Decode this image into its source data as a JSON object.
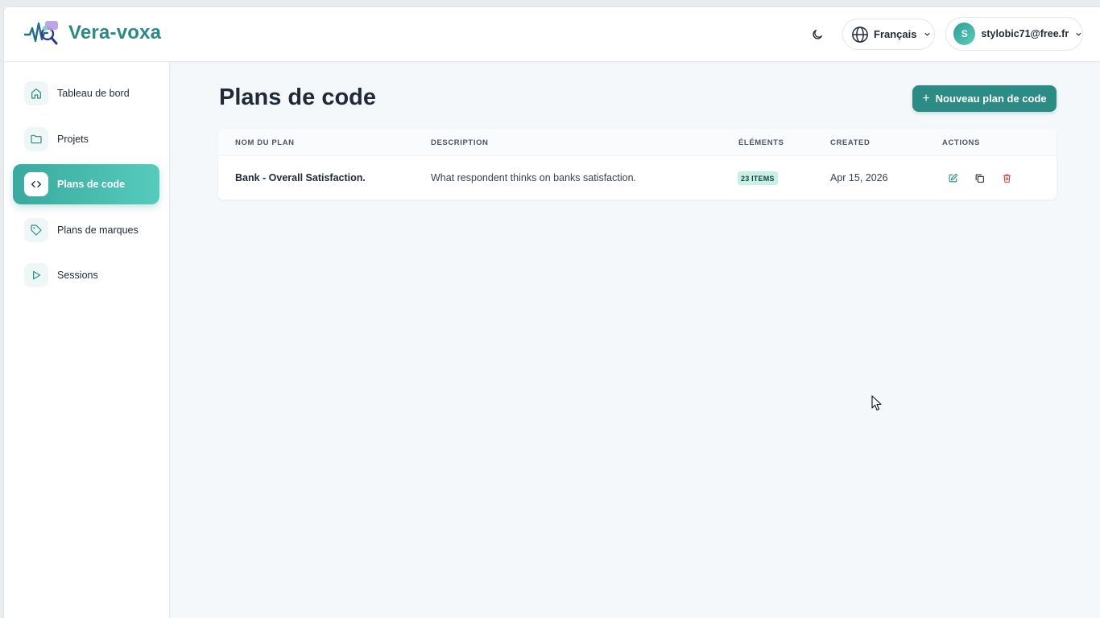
{
  "app": {
    "name": "Vera-voxa"
  },
  "header": {
    "language_label": "Français",
    "user_initial": "S",
    "user_email": "stylobic71@free.fr"
  },
  "sidebar": {
    "items": [
      {
        "label": "Tableau de bord",
        "icon": "home-icon",
        "active": false
      },
      {
        "label": "Projets",
        "icon": "folder-icon",
        "active": false
      },
      {
        "label": "Plans de code",
        "icon": "code-icon",
        "active": true
      },
      {
        "label": "Plans de marques",
        "icon": "tag-icon",
        "active": false
      },
      {
        "label": "Sessions",
        "icon": "play-icon",
        "active": false
      }
    ]
  },
  "main": {
    "title": "Plans de code",
    "new_button_label": "Nouveau plan de code",
    "table": {
      "columns": [
        "NOM DU PLAN",
        "DESCRIPTION",
        "ÉLÉMENTS",
        "CREATED",
        "ACTIONS"
      ],
      "rows": [
        {
          "name": "Bank - Overall Satisfaction.",
          "description": "What respondent thinks on banks satisfaction.",
          "elements": "23 ITEMS",
          "created": "Apr 15, 2026"
        }
      ]
    }
  },
  "colors": {
    "brand": "#2a8a86",
    "primary_button": "#2c8c85",
    "active_nav_start": "#3aa99f",
    "active_nav_end": "#56cbbc",
    "badge_bg": "#c9f0e6",
    "delete_icon": "#e03e3e"
  }
}
